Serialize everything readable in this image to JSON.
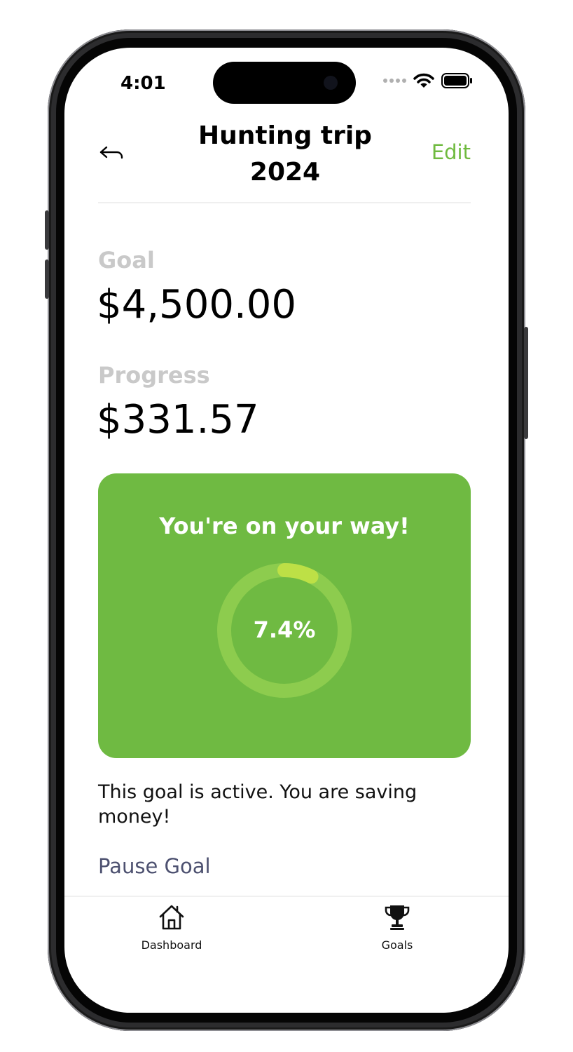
{
  "status_bar": {
    "time": "4:01"
  },
  "header": {
    "title_line1": "Hunting trip",
    "title_line2": "2024",
    "edit_label": "Edit"
  },
  "goal": {
    "label": "Goal",
    "amount": "$4,500.00"
  },
  "progress": {
    "label": "Progress",
    "amount": "$331.57"
  },
  "card": {
    "message": "You're on your way!",
    "percent_text": "7.4%",
    "percent_value": 7.4
  },
  "status_message": "This goal is active. You are saving money!",
  "pause_label": "Pause Goal",
  "tabbar": {
    "items": [
      {
        "label": "Dashboard",
        "icon": "home-icon"
      },
      {
        "label": "Goals",
        "icon": "trophy-icon"
      }
    ]
  },
  "colors": {
    "accent": "#6fba3f",
    "card_bg": "#6fba42",
    "ring_track": "#8dcc4e",
    "ring_fill": "#bde046",
    "label_gray": "#c9c9c9",
    "pause_text": "#4d5170"
  }
}
